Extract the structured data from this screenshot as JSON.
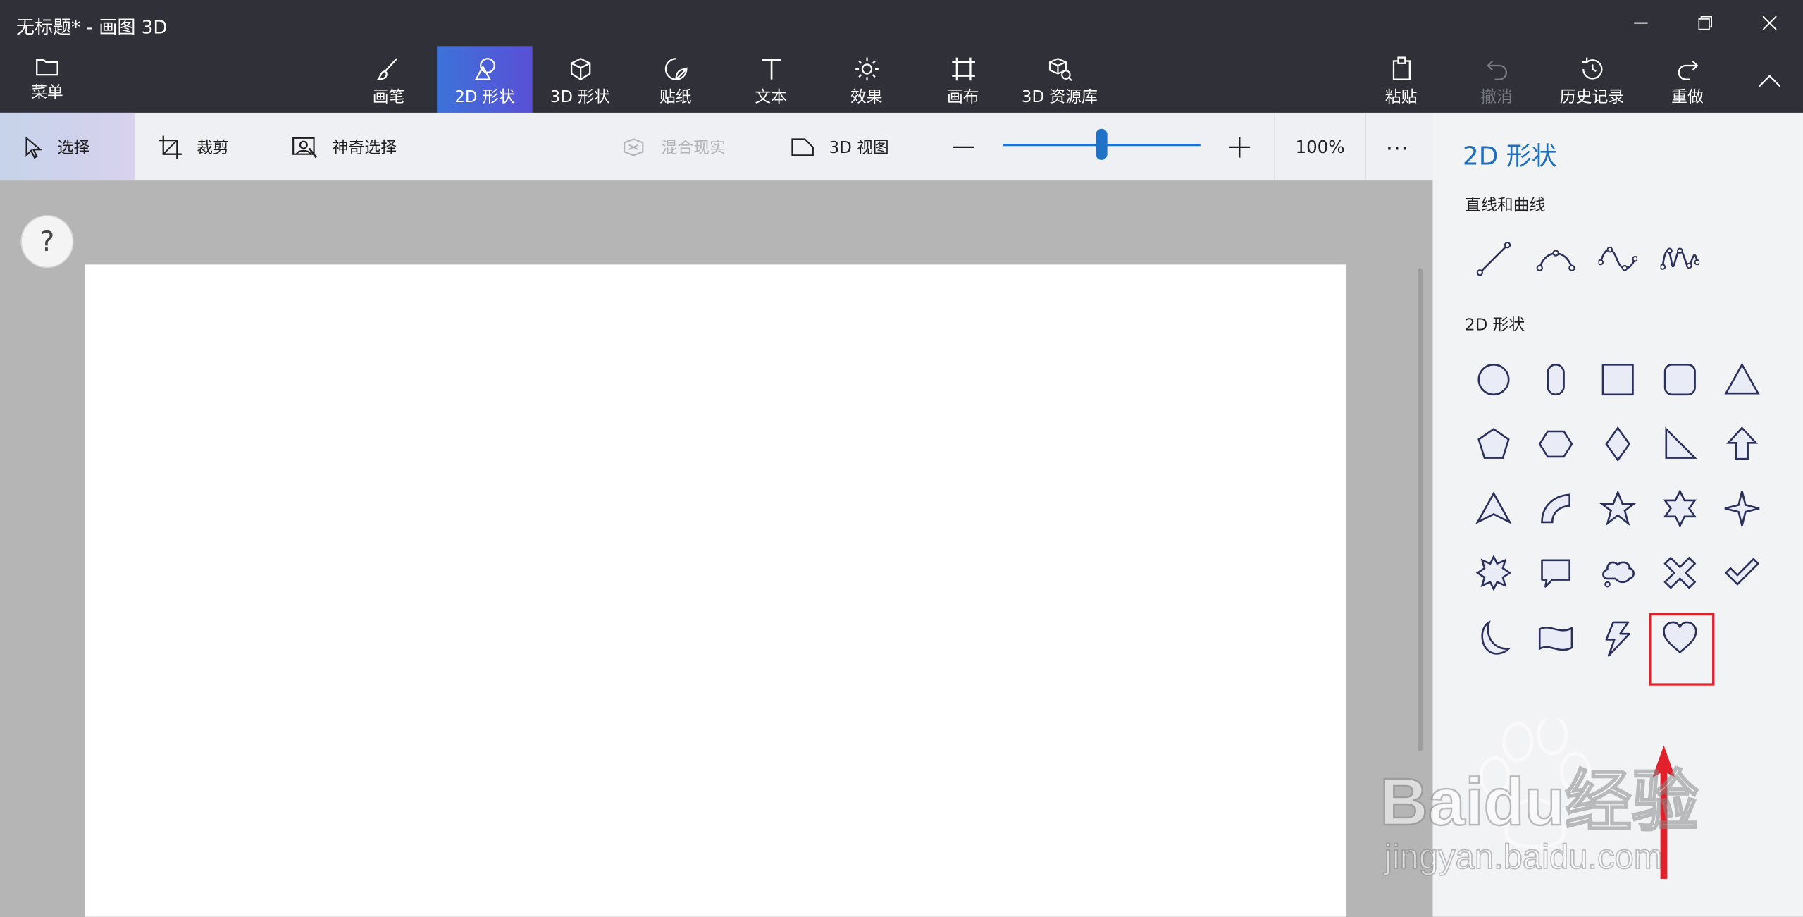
{
  "window": {
    "title": "无标题* - 画图 3D"
  },
  "ribbon": {
    "menu_label": "菜单",
    "tools": [
      {
        "label": "画笔"
      },
      {
        "label": "2D 形状",
        "active": true
      },
      {
        "label": "3D 形状"
      },
      {
        "label": "贴纸"
      },
      {
        "label": "文本"
      },
      {
        "label": "效果"
      },
      {
        "label": "画布"
      },
      {
        "label": "3D 资源库"
      }
    ],
    "right": [
      {
        "label": "粘贴"
      },
      {
        "label": "撤消",
        "disabled": true
      },
      {
        "label": "历史记录"
      },
      {
        "label": "重做"
      }
    ]
  },
  "toolbar": {
    "select": "选择",
    "crop": "裁剪",
    "magic_select": "神奇选择",
    "mixed_reality": "混合现实",
    "view_3d": "3D 视图",
    "zoom_value": "100%",
    "zoom_level": 0.5,
    "more": "⋯"
  },
  "help": {
    "label": "?"
  },
  "panel": {
    "title": "2D 形状",
    "section_lines": "直线和曲线",
    "section_shapes": "2D 形状",
    "line_items": [
      "line-icon",
      "curve-icon",
      "two-point-curve-icon",
      "three-point-curve-icon"
    ],
    "shape_items": [
      "circle-icon",
      "capsule-icon",
      "square-icon",
      "rounded-square-icon",
      "triangle-icon",
      "pentagon-icon",
      "hexagon-icon",
      "diamond-icon",
      "right-triangle-icon",
      "up-arrow-icon",
      "arrowhead-icon",
      "quarter-circle-icon",
      "five-point-star-icon",
      "six-point-star-icon",
      "four-point-star-icon",
      "burst-icon",
      "speech-bubble-icon",
      "thought-bubble-icon",
      "cross-icon",
      "checkmark-icon",
      "moon-icon",
      "banner-icon",
      "lightning-icon",
      "heart-icon"
    ],
    "selected": "heart-icon"
  },
  "watermark": {
    "line1": "Baidu经验",
    "line2": "jingyan.baidu.com"
  },
  "colors": {
    "accent": "#1f6fbf",
    "titlebar": "#2f3038",
    "highlight": "#e0212b",
    "icon": "#2a2f5b"
  }
}
